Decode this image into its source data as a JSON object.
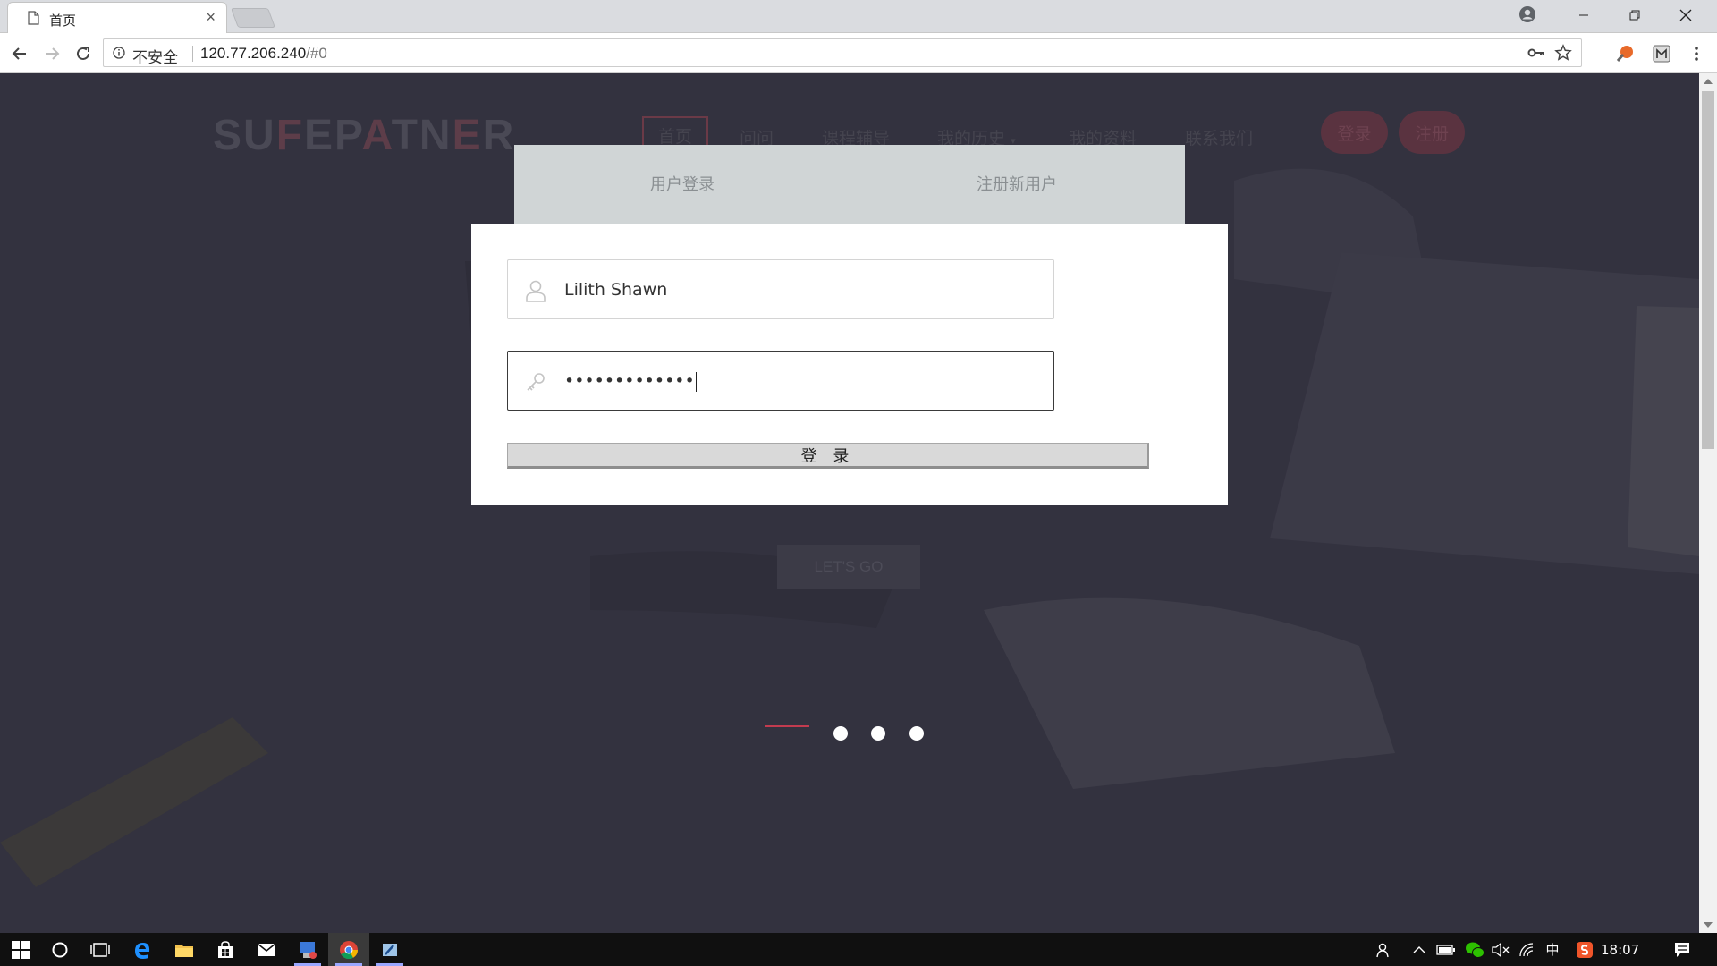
{
  "browser": {
    "tab_title": "首页",
    "tab_close": "×",
    "security_label": "不安全",
    "url_host": "120.77.206.240",
    "url_fragment": "/#0"
  },
  "site": {
    "logo": [
      "SU",
      "F",
      "EP",
      "A",
      "TN",
      "E",
      "R"
    ],
    "nav": [
      "首页",
      "问问",
      "课程辅导",
      "我的历史",
      "我的资料",
      "联系我们"
    ],
    "login_pill": "登录",
    "register_pill": "注册",
    "hero_button": "LET'S GO"
  },
  "modal": {
    "tab_login": "用户登录",
    "tab_register": "注册新用户",
    "username_value": "Lilith Shawn",
    "password_value": "•••••••••••••",
    "submit_label": "登 录"
  },
  "taskbar": {
    "ime": "中",
    "clock": "18:07"
  },
  "colors": {
    "page_bg": "#33323f",
    "accent": "#c33b4f",
    "modal_tabs_bg": "#d0d5d6"
  }
}
